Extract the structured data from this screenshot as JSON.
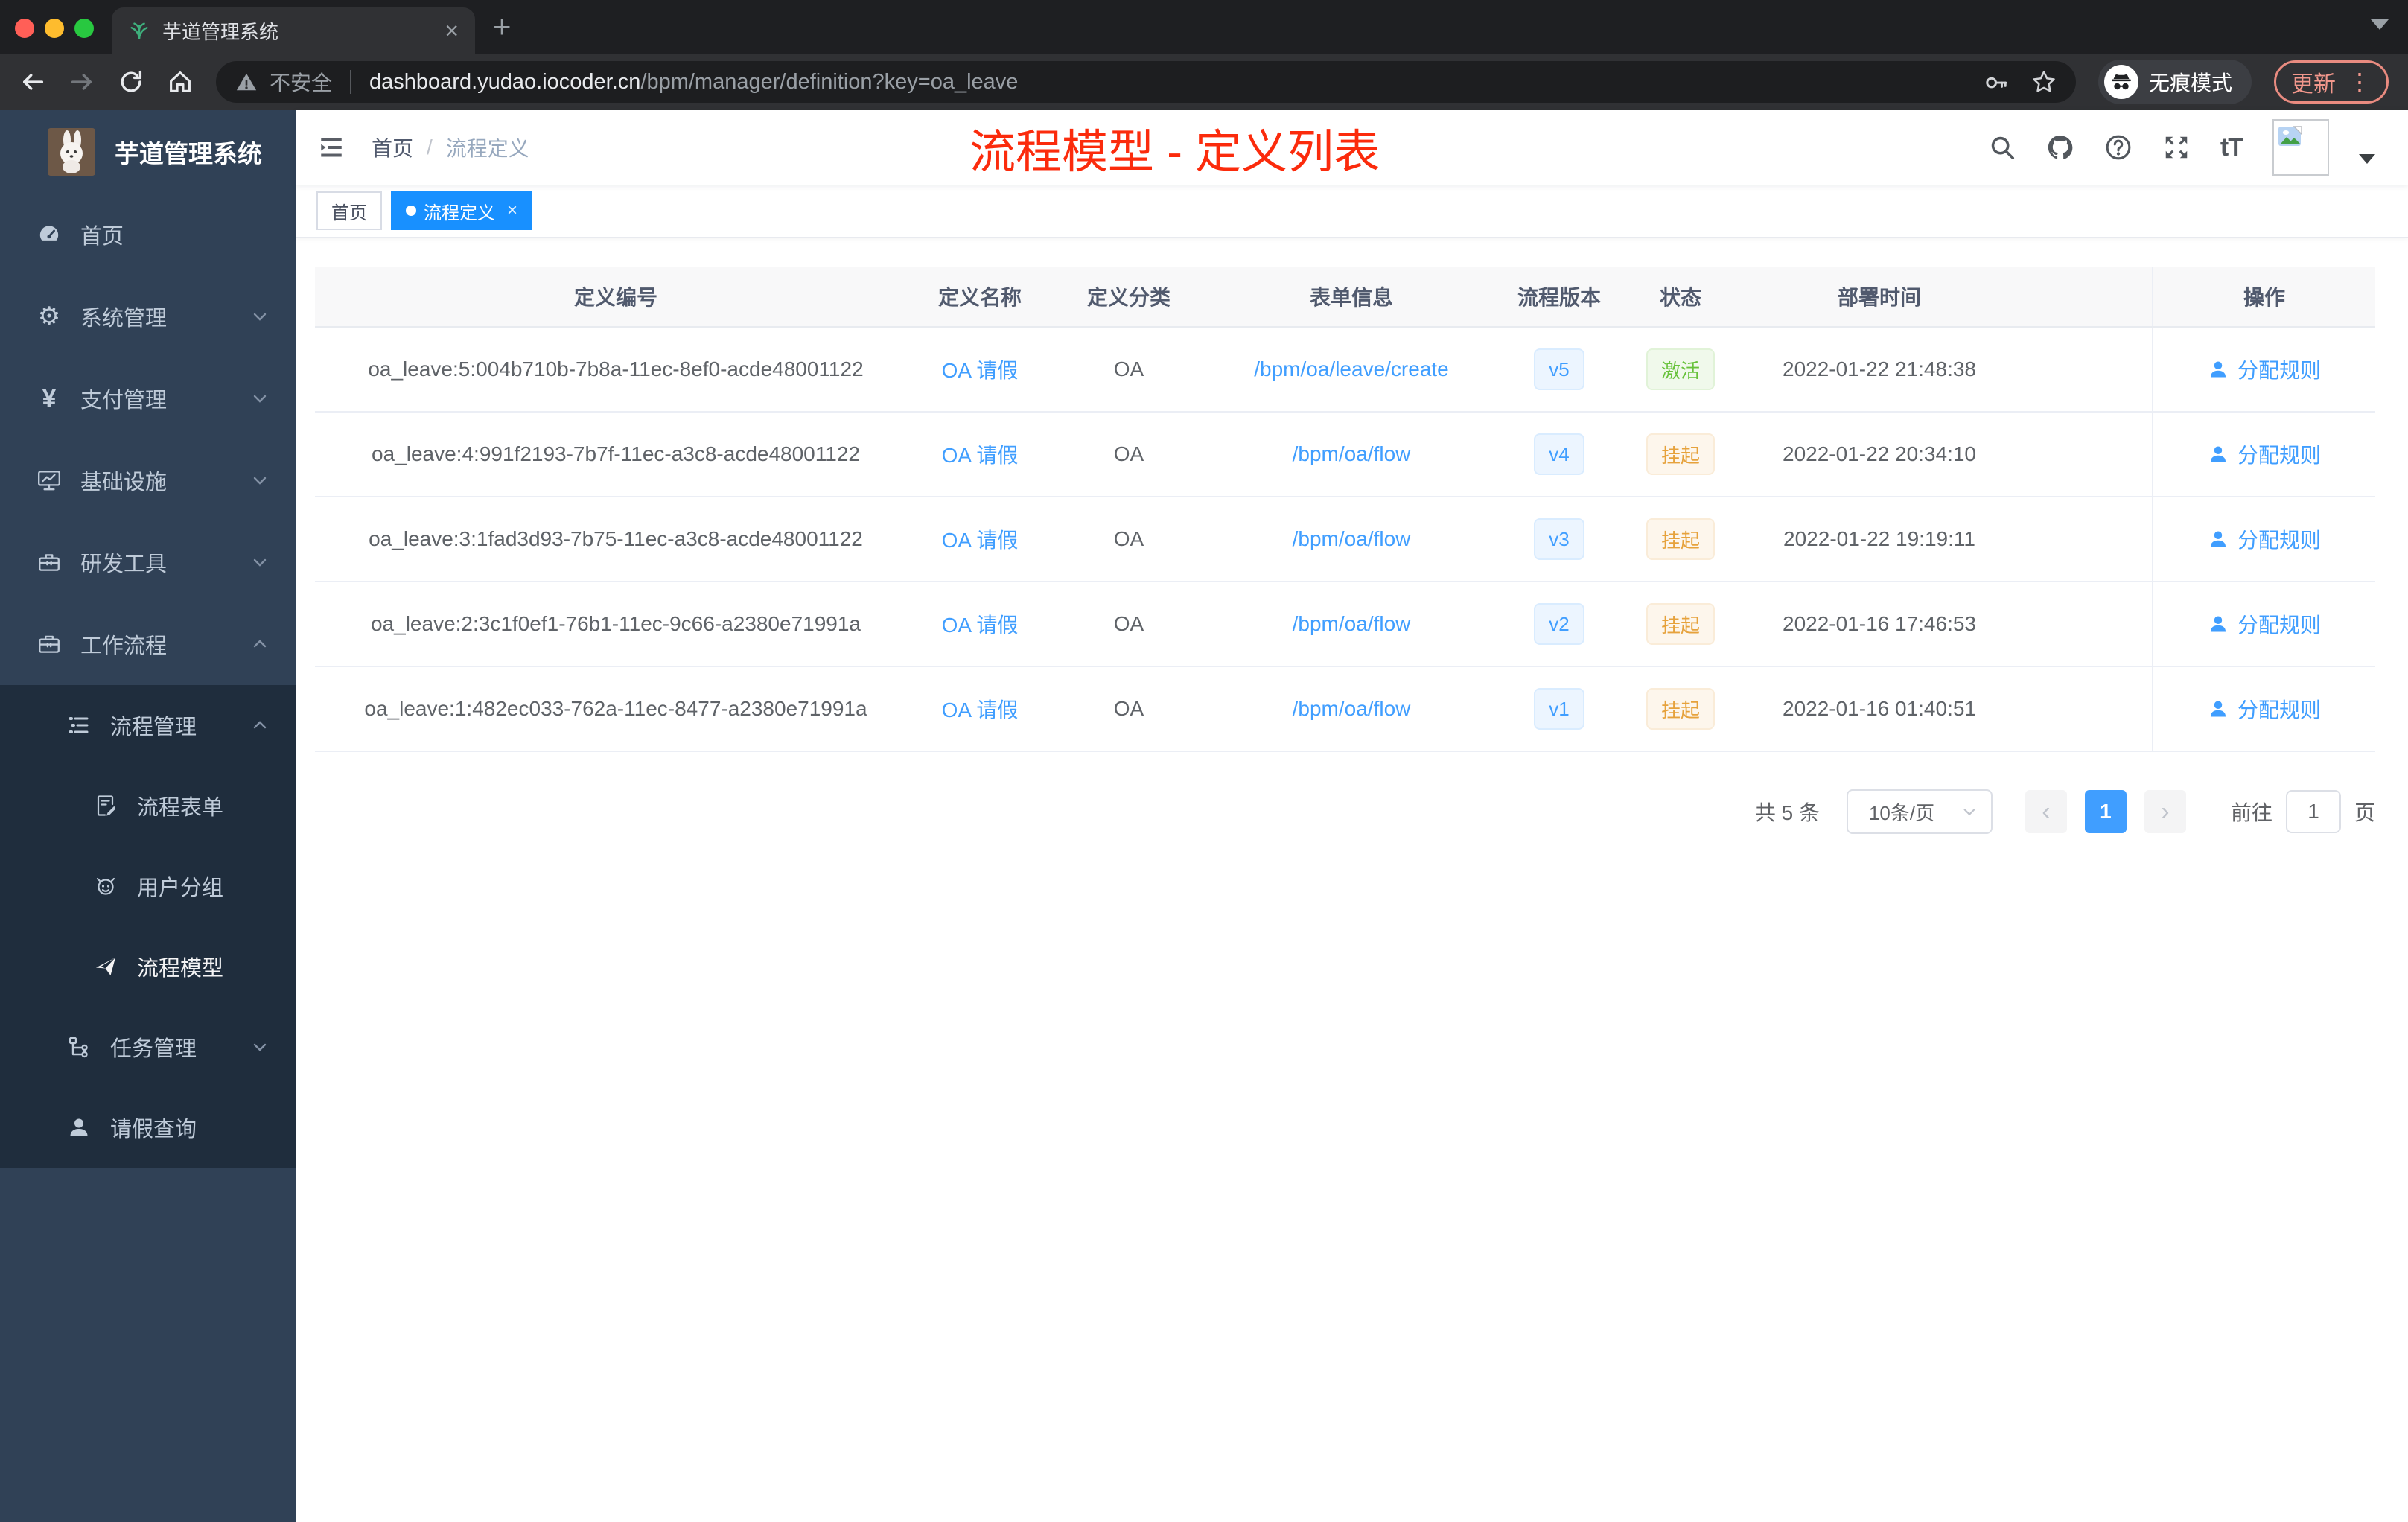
{
  "colors": {
    "accent": "#409eff",
    "tag_active": "#1890ff",
    "success": "#67c23a",
    "warning": "#e6a23c",
    "annotation": "#fb2b0c"
  },
  "browser": {
    "tab_title": "芋道管理系统",
    "new_tab": "+",
    "close_tab": "×",
    "security_label": "不安全",
    "url_host": "dashboard.yudao.iocoder.cn",
    "url_path": "/bpm/manager/definition?key=oa_leave",
    "incognito_label": "无痕模式",
    "update_label": "更新",
    "menu_dots": "⋮"
  },
  "sidebar": {
    "title": "芋道管理系统",
    "top_items": [
      {
        "label": "首页"
      },
      {
        "label": "系统管理"
      },
      {
        "label": "支付管理"
      },
      {
        "label": "基础设施"
      },
      {
        "label": "研发工具"
      },
      {
        "label": "工作流程"
      }
    ],
    "process_group": {
      "label": "流程管理",
      "children": [
        {
          "label": "流程表单"
        },
        {
          "label": "用户分组"
        },
        {
          "label": "流程模型"
        }
      ]
    },
    "task_group": {
      "label": "任务管理"
    },
    "leave_item": {
      "label": "请假查询"
    },
    "yen_glyph": "¥",
    "gear_glyph": "⚙"
  },
  "navbar": {
    "breadcrumb_home": "首页",
    "breadcrumb_sep": "/",
    "breadcrumb_current": "流程定义",
    "annotation": "流程模型 - 定义列表",
    "font_icon_label": "tT"
  },
  "tags": [
    {
      "label": "首页"
    },
    {
      "label": "流程定义",
      "close": "×"
    }
  ],
  "table": {
    "columns": [
      "定义编号",
      "定义名称",
      "定义分类",
      "表单信息",
      "流程版本",
      "状态",
      "部署时间",
      "操作"
    ],
    "action_label": "分配规则",
    "rows": [
      {
        "id": "oa_leave:5:004b710b-7b8a-11ec-8ef0-acde48001122",
        "name": "OA 请假",
        "category": "OA",
        "form": "/bpm/oa/leave/create",
        "version": "v5",
        "status": "激活",
        "time": "2022-01-22 21:48:38"
      },
      {
        "id": "oa_leave:4:991f2193-7b7f-11ec-a3c8-acde48001122",
        "name": "OA 请假",
        "category": "OA",
        "form": "/bpm/oa/flow",
        "version": "v4",
        "status": "挂起",
        "time": "2022-01-22 20:34:10"
      },
      {
        "id": "oa_leave:3:1fad3d93-7b75-11ec-a3c8-acde48001122",
        "name": "OA 请假",
        "category": "OA",
        "form": "/bpm/oa/flow",
        "version": "v3",
        "status": "挂起",
        "time": "2022-01-22 19:19:11"
      },
      {
        "id": "oa_leave:2:3c1f0ef1-76b1-11ec-9c66-a2380e71991a",
        "name": "OA 请假",
        "category": "OA",
        "form": "/bpm/oa/flow",
        "version": "v2",
        "status": "挂起",
        "time": "2022-01-16 17:46:53"
      },
      {
        "id": "oa_leave:1:482ec033-762a-11ec-8477-a2380e71991a",
        "name": "OA 请假",
        "category": "OA",
        "form": "/bpm/oa/flow",
        "version": "v1",
        "status": "挂起",
        "time": "2022-01-16 01:40:51"
      }
    ]
  },
  "pagination": {
    "total": "共 5 条",
    "page_size": "10条/页",
    "prev": "‹",
    "current": "1",
    "next": "›",
    "goto": "前往",
    "unit": "页",
    "goto_value": "1"
  }
}
